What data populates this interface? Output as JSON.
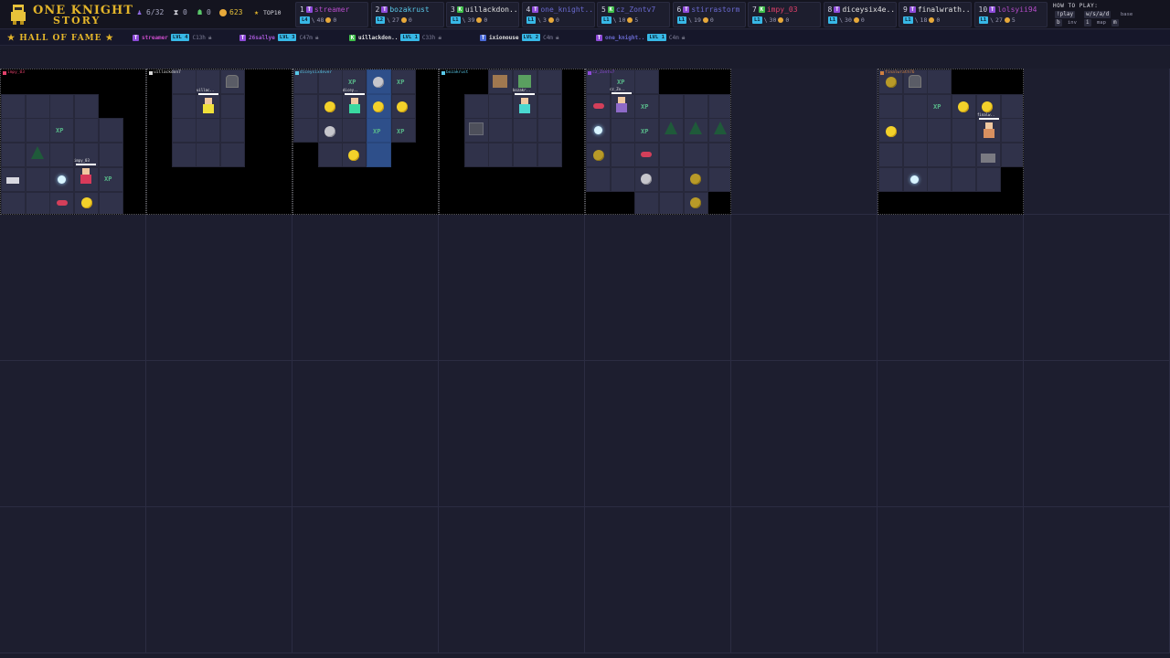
{
  "header": {
    "logo_line1": "ONE KNIGHT",
    "logo_line2": "STORY",
    "players": "6/32",
    "hourglass": "0",
    "kills": "0",
    "gold": "623",
    "top10_label": "TOP10"
  },
  "leaderboard": [
    {
      "rank": "1",
      "platform": "T",
      "name": "streamer",
      "level": "L4",
      "xp": "48",
      "gold": "0",
      "color": "#b44cc8",
      "pcolor": "#8e4bd8"
    },
    {
      "rank": "2",
      "platform": "T",
      "name": "bozakrust",
      "level": "L2",
      "xp": "27",
      "gold": "0",
      "color": "#59c8e8",
      "pcolor": "#8e4bd8"
    },
    {
      "rank": "3",
      "platform": "K",
      "name": "uillackdon..",
      "level": "L1",
      "xp": "39",
      "gold": "0",
      "color": "#e0e0e0",
      "pcolor": "#3fbf4a"
    },
    {
      "rank": "4",
      "platform": "T",
      "name": "one_knight..",
      "level": "L1",
      "xp": "3",
      "gold": "0",
      "color": "#6a6ad0",
      "pcolor": "#8e4bd8"
    },
    {
      "rank": "5",
      "platform": "K",
      "name": "cz_Zontv7",
      "level": "L1",
      "xp": "10",
      "gold": "5",
      "color": "#6a6ad0",
      "pcolor": "#3fbf4a"
    },
    {
      "rank": "6",
      "platform": "T",
      "name": "stirrastorm",
      "level": "L1",
      "xp": "19",
      "gold": "0",
      "color": "#6a6ad0",
      "pcolor": "#8e4bd8"
    },
    {
      "rank": "7",
      "platform": "K",
      "name": "impy_03",
      "level": "L1",
      "xp": "30",
      "gold": "0",
      "color": "#e0406a",
      "pcolor": "#3fbf4a"
    },
    {
      "rank": "8",
      "platform": "T",
      "name": "diceysix4e..",
      "level": "L1",
      "xp": "30",
      "gold": "0",
      "color": "#e0e0e0",
      "pcolor": "#8e4bd8"
    },
    {
      "rank": "9",
      "platform": "T",
      "name": "finalwrath..",
      "level": "L1",
      "xp": "18",
      "gold": "0",
      "color": "#e0e0e0",
      "pcolor": "#8e4bd8"
    },
    {
      "rank": "10",
      "platform": "T",
      "name": "lolsyii94",
      "level": "L1",
      "xp": "27",
      "gold": "5",
      "color": "#b44cc8",
      "pcolor": "#8e4bd8"
    }
  ],
  "howto": {
    "title": "HOW TO PLAY:",
    "k1": "!play",
    "k2": "w/s/a/d",
    "l1": "base",
    "k3": "b",
    "l2": "inv",
    "k4": "i",
    "l3": "map",
    "k5": "m"
  },
  "hall_of_fame": {
    "title": "★ HALL OF FAME ★",
    "entries": [
      {
        "platform": "T",
        "name": "streamer",
        "level": "LVL 4",
        "meta": "C13h",
        "color": "#c84cc8",
        "pcolor": "#8e4bd8"
      },
      {
        "platform": "T",
        "name": "26sallye",
        "level": "LVL 3",
        "meta": "C47m",
        "color": "#a85ad8",
        "pcolor": "#8e4bd8"
      },
      {
        "platform": "K",
        "name": "uillackdon..",
        "level": "LVL 1",
        "meta": "C33h",
        "color": "#e0e0e0",
        "pcolor": "#3fbf4a"
      },
      {
        "platform": "T",
        "name": "ixionouse",
        "level": "LVL 2",
        "meta": "C4m",
        "color": "#e0e0e0",
        "pcolor": "#4a6ad8"
      },
      {
        "platform": "T",
        "name": "one_knight..",
        "level": "LVL 1",
        "meta": "C4m",
        "color": "#6a6ad0",
        "pcolor": "#8e4bd8"
      }
    ]
  },
  "viewports": [
    {
      "owner": "impy_03",
      "color": "#e0406a"
    },
    {
      "owner": "uillackdon7",
      "color": "#d8d8d8"
    },
    {
      "owner": "diceysix4ever",
      "color": "#59c8e8"
    },
    {
      "owner": "bozakrust",
      "color": "#59c8e8"
    },
    {
      "owner": "cz_Zontv7",
      "color": "#8e4bd8"
    },
    {
      "owner": "finalwrath76",
      "color": "#d08040"
    }
  ],
  "sprites": {
    "v0_hero": "impy_03",
    "v1_hero": "uillac..",
    "v2_hero": "dicey..",
    "v3_hero": "bozakr..",
    "v4_hero": "cz_Zo..",
    "v5_hero": "finalw.."
  },
  "icons": {
    "players": "person-icon",
    "hourglass": "hourglass-icon",
    "kills": "skull-icon",
    "gold": "coin-icon",
    "top10": "star-icon"
  }
}
